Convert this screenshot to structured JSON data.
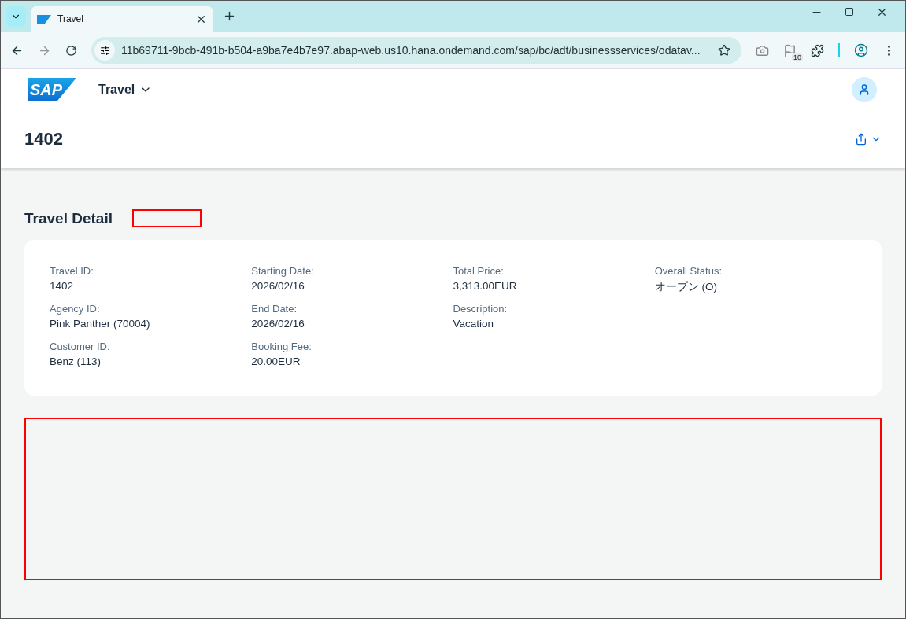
{
  "browser": {
    "tab": {
      "title": "Travel",
      "selected": true
    },
    "url": "11b69711-9bcb-491b-b504-a9ba7e4b7e97.abap-web.us10.hana.ondemand.com/sap/bc/adt/businessservices/odatav...",
    "flag_badge": "10"
  },
  "shell": {
    "logo_text": "SAP",
    "app_title": "Travel"
  },
  "object_header": {
    "title": "1402"
  },
  "section": {
    "title": "Travel Detail"
  },
  "fields": [
    [
      {
        "label": "Travel ID:",
        "value": "1402"
      },
      {
        "label": "Agency ID:",
        "value": "Pink Panther (70004)"
      },
      {
        "label": "Customer ID:",
        "value": "Benz (113)"
      }
    ],
    [
      {
        "label": "Starting Date:",
        "value": "2026/02/16"
      },
      {
        "label": "End Date:",
        "value": "2026/02/16"
      },
      {
        "label": "Booking Fee:",
        "value": "20.00EUR"
      }
    ],
    [
      {
        "label": "Total Price:",
        "value": "3,313.00EUR"
      },
      {
        "label": "Description:",
        "value": "Vacation"
      }
    ],
    [
      {
        "label": "Overall Status:",
        "value": "オープン (O)"
      }
    ]
  ]
}
